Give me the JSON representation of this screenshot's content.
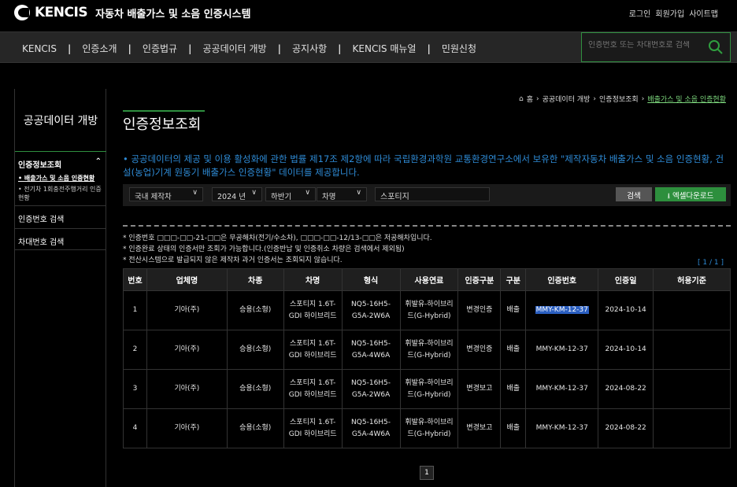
{
  "header": {
    "logo_text": "KENCIS",
    "logo_sub": "자동차 배출가스 및 소음 인증시스템",
    "links": [
      "로그인",
      "회원가입",
      "사이트맵"
    ]
  },
  "nav": {
    "items": [
      "KENCIS",
      "인증소개",
      "인증법규",
      "공공데이터 개방",
      "공지사항",
      "KENCIS 매뉴얼",
      "민원신청"
    ],
    "search_placeholder": "인증번호 또는 차대번호로 검색"
  },
  "sidebar": {
    "title": "공공데이터 개방",
    "section": "인증정보조회",
    "sub_items": [
      {
        "label": "• 배출가스 및 소음 인증현황",
        "active": true
      },
      {
        "label": "• 전기차 1회충전주행거리 인증현황",
        "active": false
      }
    ],
    "rows": [
      "인증번호 검색",
      "차대번호 검색"
    ]
  },
  "breadcrumb": [
    "홈",
    "공공데이터 개방",
    "인증정보조회",
    "배출가스 및 소음 인증현황"
  ],
  "page_title": "인증정보조회",
  "description": "• 공공데이터의 제공 및 이용 활성화에 관한 법률 제17조 제2항에 따라 국립환경과학원 교통환경연구소에서 보유한 \"제작자동차 배출가스 및 소음 인증현황, 건설(농업)기계 원동기 배출가스 인증현황\" 데이터를 제공합니다.",
  "filters": {
    "origin": "국내 제작차",
    "year": "2024 년",
    "half": "하반기",
    "field": "차명",
    "keyword": "스포티지",
    "search_label": "검색",
    "excel_label": "엑셀다운로드"
  },
  "notes": [
    "* 인증번호 □□□-□□-21-□□은 무공해차(전기/수소차), □□□-□□-12/13-□□은 저공해차입니다.",
    "* 인증완료 상태의 인증서만 조회가 가능합니다.(인증반납 및 인증취소 차량은 검색에서 제외됨)",
    "* 전산시스템으로 발급되지 않은 제작차 과거 인증서는 조회되지 않습니다."
  ],
  "page_info": "[ 1 / 1 ]",
  "table": {
    "headers": [
      "번호",
      "업체명",
      "차종",
      "차명",
      "형식",
      "사용연료",
      "인증구분",
      "구분",
      "인증번호",
      "인증일",
      "허용기준"
    ],
    "rows": [
      [
        "1",
        "기아(주)",
        "승용(소형)",
        "스포티지 1.6T-GDI 하이브리드",
        "NQ5-16H5-G5A-2W6A",
        "휘발유-하이브리드(G-Hybrid)",
        "변경인증",
        "배출",
        "MMY-KM-12-37",
        "2024-10-14",
        ""
      ],
      [
        "2",
        "기아(주)",
        "승용(소형)",
        "스포티지 1.6T-GDI 하이브리드",
        "NQ5-16H5-G5A-4W6A",
        "휘발유-하이브리드(G-Hybrid)",
        "변경인증",
        "배출",
        "MMY-KM-12-37",
        "2024-10-14",
        ""
      ],
      [
        "3",
        "기아(주)",
        "승용(소형)",
        "스포티지 1.6T-GDI 하이브리드",
        "NQ5-16H5-G5A-2W6A",
        "휘발유-하이브리드(G-Hybrid)",
        "변경보고",
        "배출",
        "MMY-KM-12-37",
        "2024-08-22",
        ""
      ],
      [
        "4",
        "기아(주)",
        "승용(소형)",
        "스포티지 1.6T-GDI 하이브리드",
        "NQ5-16H5-G5A-4W6A",
        "휘발유-하이브리드(G-Hybrid)",
        "변경보고",
        "배출",
        "MMY-KM-12-37",
        "2024-08-22",
        ""
      ]
    ]
  },
  "pagination": {
    "current": "1"
  },
  "colors": {
    "accent": "#2f8f3f",
    "link_blue": "#2e8bd6",
    "selection": "#2b5fc1"
  }
}
